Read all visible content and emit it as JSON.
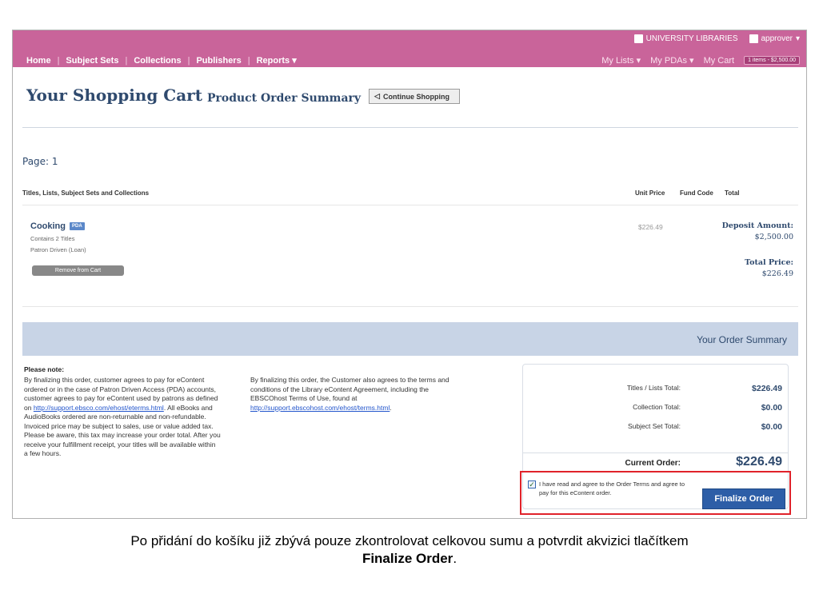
{
  "utility": {
    "library": "UNIVERSITY LIBRARIES",
    "user": "approver",
    "user_caret": "▾"
  },
  "nav": {
    "left": [
      "Home",
      "Subject Sets",
      "Collections",
      "Publishers",
      "Reports ▾"
    ],
    "right": {
      "lists": "My Lists ▾",
      "pdas": "My PDAs ▾",
      "cart": "My Cart",
      "cart_badge": "1 items - $2,500.00"
    }
  },
  "heading": {
    "title": "Your Shopping Cart",
    "subtitle": "Product Order Summary",
    "continue": "Continue Shopping"
  },
  "page": {
    "label": "Page: 1"
  },
  "columns": {
    "titles": "Titles, Lists, Subject Sets and Collections",
    "unit_price": "Unit Price",
    "fund_code": "Fund Code",
    "total": "Total"
  },
  "item": {
    "title": "Cooking",
    "badge": "PDA",
    "line1": "Contains 2 Titles",
    "line2": "Patron Driven (Loan)",
    "remove": "Remove from Cart",
    "unit_price": "$226.49",
    "deposit_label": "Deposit Amount:",
    "deposit_value": "$2,500.00",
    "total_label": "Total Price:",
    "total_value": "$226.49"
  },
  "summary": {
    "title": "Your Order Summary",
    "titles_lists_label": "Titles / Lists Total:",
    "titles_lists_value": "$226.49",
    "collection_label": "Collection Total:",
    "collection_value": "$0.00",
    "subject_set_label": "Subject Set Total:",
    "subject_set_value": "$0.00",
    "current_label": "Current Order:",
    "current_value": "$226.49"
  },
  "note": {
    "heading": "Please note:",
    "col1_a": "By finalizing this order, customer agrees to pay for eContent ordered or in the case of Patron Driven Access (PDA) accounts, customer agrees to pay for eContent used by patrons as defined on ",
    "col1_link": "http://support.ebsco.com/ehost/eterms.html",
    "col1_b": ". All eBooks and AudioBooks ordered are non-returnable and non-refundable. Invoiced price may be subject to sales, use or value added tax. Please be aware, this tax may increase your order total. After you receive your fulfillment receipt, your titles will be available within a few hours.",
    "col2_a": "By finalizing this order, the Customer also agrees to the terms and conditions of the Library eContent Agreement, including the EBSCOhost Terms of Use, found at ",
    "col2_link": "http://support.ebscohost.com/ehost/terms.html",
    "col2_b": "."
  },
  "agree": {
    "text": "I have read and agree to the Order Terms and agree to pay for this eContent order.",
    "checked": true,
    "button": "Finalize Order"
  },
  "caption": {
    "line1": "Po přidání do košíku již zbývá pouze zkontrolovat celkovou sumu a potvrdit akvizici tlačítkem",
    "line2": "Finalize Order",
    "line2_end": "."
  },
  "colors": {
    "brand": "#c9649a",
    "accent": "#2f4a6e",
    "button": "#2d5ea7",
    "highlight": "#e0222a"
  }
}
